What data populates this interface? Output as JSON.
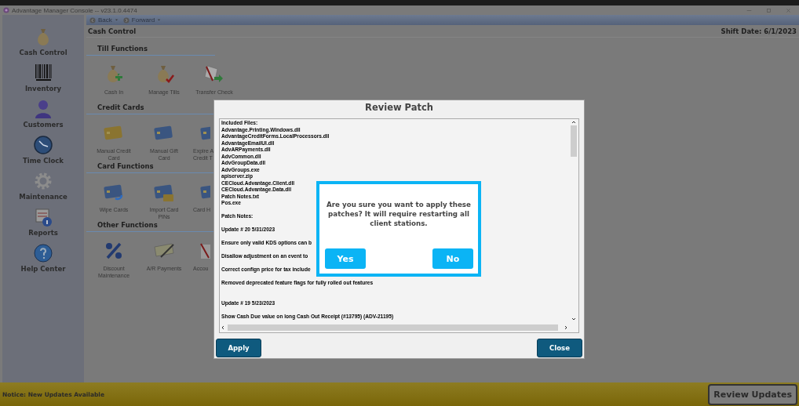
{
  "window": {
    "title": "Advantage Manager Console -- v23.1.0.4474"
  },
  "nav": {
    "back": "Back",
    "forward": "Forward"
  },
  "sidebar": {
    "items": [
      {
        "label": "Cash Control"
      },
      {
        "label": "Inventory"
      },
      {
        "label": "Customers"
      },
      {
        "label": "Time Clock"
      },
      {
        "label": "Maintenance"
      },
      {
        "label": "Reports"
      },
      {
        "label": "Help Center"
      }
    ]
  },
  "page": {
    "title": "Cash Control",
    "shift_date": "Shift Date: 6/1/2023"
  },
  "sections": [
    {
      "title": "Till Functions",
      "tiles": [
        {
          "lines": [
            "Cash In"
          ],
          "clipped": false
        },
        {
          "lines": [
            "Manage Tills"
          ],
          "clipped": false
        },
        {
          "lines": [
            "Transfer Check"
          ],
          "clipped": false
        }
      ]
    },
    {
      "title": "Credit Cards",
      "tiles": [
        {
          "lines": [
            "Manual Credit",
            "Card"
          ],
          "clipped": false
        },
        {
          "lines": [
            "Manual Gift",
            "Card"
          ],
          "clipped": false
        },
        {
          "lines": [
            "Expire A",
            "Credit T"
          ],
          "clipped": true
        }
      ]
    },
    {
      "title": "Card Functions",
      "tiles": [
        {
          "lines": [
            "Wipe Cards"
          ],
          "clipped": false
        },
        {
          "lines": [
            "Import Card",
            "PINs"
          ],
          "clipped": false
        },
        {
          "lines": [
            "Card H"
          ],
          "clipped": true
        }
      ]
    },
    {
      "title": "Other Functions",
      "tiles": [
        {
          "lines": [
            "Discount",
            "Maintenance"
          ],
          "clipped": false
        },
        {
          "lines": [
            "A/R Payments"
          ],
          "clipped": false
        },
        {
          "lines": [
            "Accou"
          ],
          "clipped": true
        }
      ]
    }
  ],
  "dialog": {
    "title": "Review Patch",
    "files_heading": "Included Files:",
    "files": [
      "Advantage.Printing.Windows.dll",
      "AdvantageCreditForms.LocalProcessors.dll",
      "AdvantageEmailUI.dll",
      "AdvARPayments.dll",
      "AdvCommon.dll",
      "AdvGroupData.dll",
      "AdvGroups.exe",
      "apiserver.zip",
      "CECloud.Advantage.Client.dll",
      "CECloud.Advantage.Data.dll",
      "Patch Notes.txt",
      "Pos.exe"
    ],
    "notes_heading": "Patch Notes:",
    "updates": [
      {
        "title": "Update # 20 5/31/2023",
        "notes": [
          "Ensure only valid KDS options can b",
          "Disallow adjustment on an event to",
          "Correct confign price for tax include",
          "Removed deprecated feature flags for fully rolled out features"
        ]
      },
      {
        "title": "Update # 19 5/23/2023",
        "notes": [
          "Show Cash Due value on long Cash Out Receipt (#13795) (ADV-21195)"
        ]
      }
    ],
    "buttons": [
      "Apply",
      "Close"
    ]
  },
  "confirm": {
    "message": "Are you sure you want to apply these patches?  It will require restarting all client stations.",
    "buttons": [
      "Yes",
      "No"
    ]
  },
  "notice": {
    "text": "Notice: New Updates Available",
    "button": "Review Updates"
  }
}
